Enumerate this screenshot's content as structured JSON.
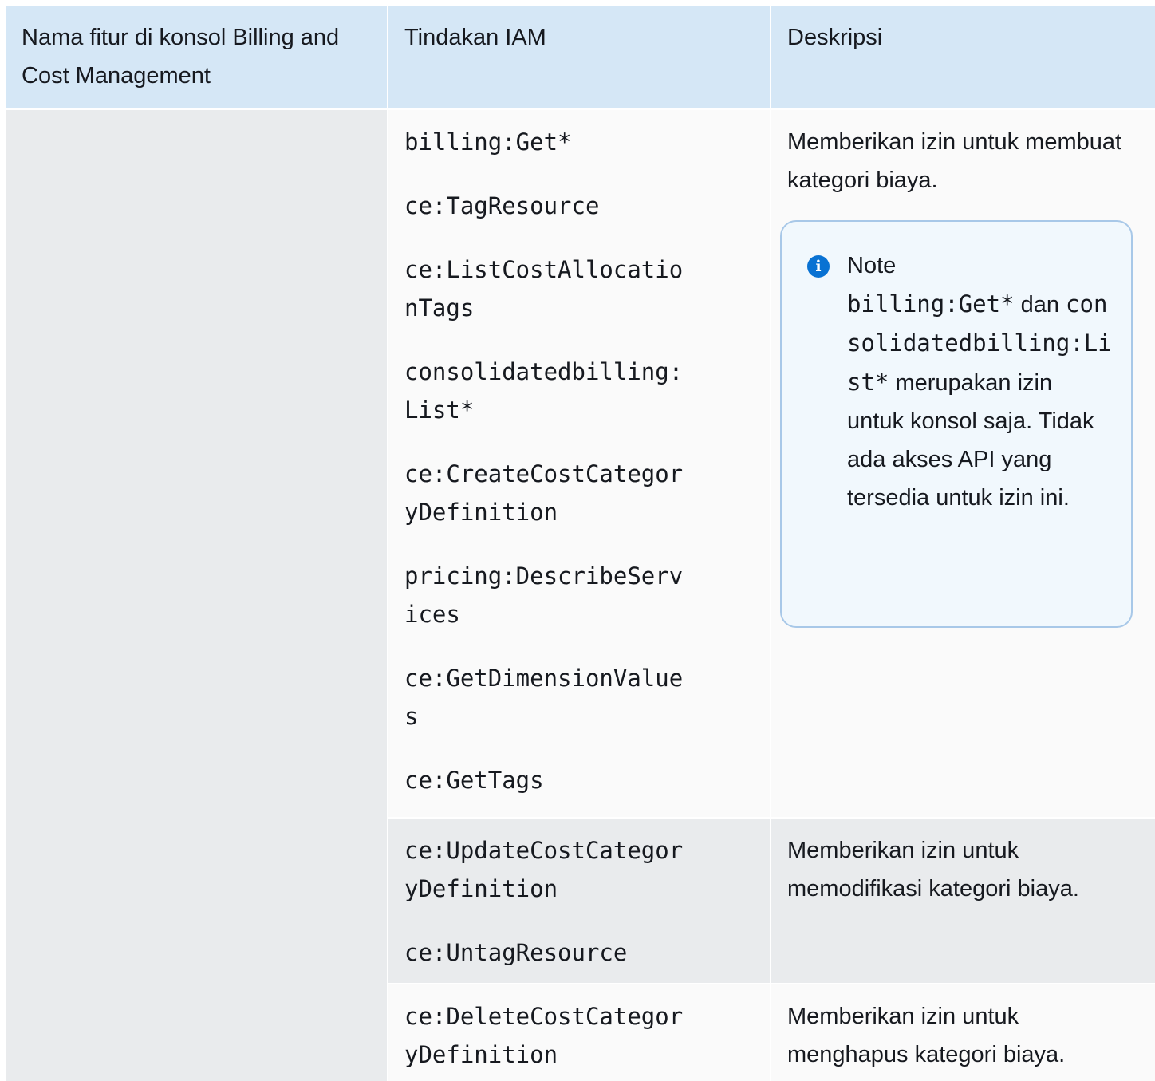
{
  "headers": {
    "feature": "Nama fitur di konsol Billing and Cost Management",
    "iam_action": "Tindakan IAM",
    "description": "Deskripsi"
  },
  "rows": [
    {
      "actions": [
        "billing:Get*",
        "ce:TagResource",
        "ce:ListCostAllocationTags",
        "consolidatedbilling:List*",
        "ce:CreateCostCategoryDefinition",
        "pricing:DescribeServices",
        "ce:GetDimensionValues",
        "ce:GetTags"
      ],
      "description": "Memberikan izin untuk membuat kategori biaya.",
      "note": {
        "title": "Note",
        "code1": "billing:Get*",
        "text1": "dan",
        "code2": "consolidatedbilling:List*",
        "text2": "merupakan izin untuk konsol saja. Tidak ada akses API yang tersedia untuk izin ini."
      }
    },
    {
      "actions": [
        "ce:UpdateCostCategoryDefinition",
        "ce:UntagResource"
      ],
      "description": "Memberikan izin untuk memodifikasi kategori biaya."
    },
    {
      "actions": [
        "ce:DeleteCostCategoryDefinition"
      ],
      "description": "Memberikan izin untuk menghapus kategori biaya."
    }
  ],
  "icons": {
    "note_icon": "info-circle-icon"
  },
  "colors": {
    "header_bg": "#d5e7f6",
    "row_gray": "#e9ebed",
    "row_light": "#fafafa",
    "note_border": "#a8c8e8",
    "note_bg": "#f1f8fd",
    "info_blue": "#0972d3"
  }
}
